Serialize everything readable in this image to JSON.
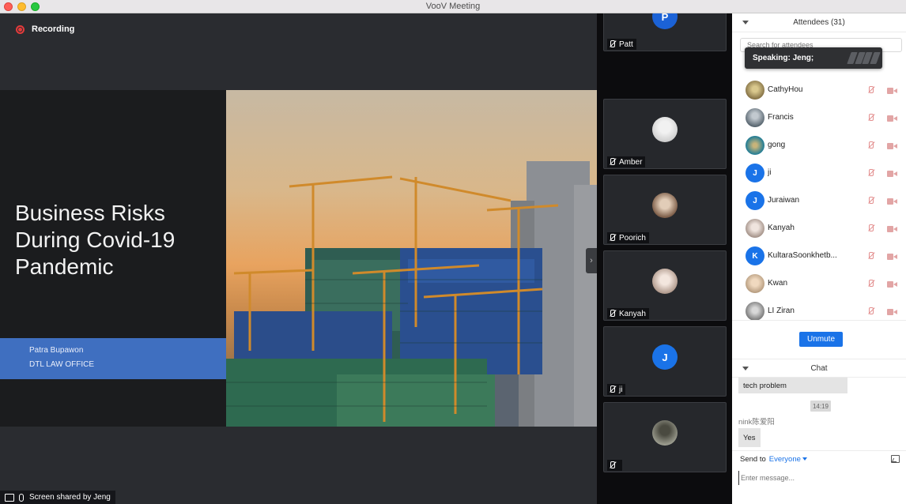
{
  "window": {
    "title": "VooV Meeting"
  },
  "recording": {
    "label": "Recording"
  },
  "slide": {
    "title": "Business Risks\nDuring Covid-19\nPandemic",
    "author": "Patra Bupawon",
    "org": "DTL LAW OFFICE"
  },
  "share_bar": {
    "label": "Screen shared by Jeng"
  },
  "video_tiles": [
    {
      "name": "Patt",
      "initial": "P",
      "avatar_color": "#1b62d6"
    },
    {
      "name": "Amber",
      "initial": "",
      "avatar_color": "#d7d7d7"
    },
    {
      "name": "Poorich",
      "initial": "",
      "avatar_color": "#b69a86"
    },
    {
      "name": "Kanyah",
      "initial": "",
      "avatar_color": "#dcd5cf"
    },
    {
      "name": "ji",
      "initial": "J",
      "avatar_color": "#1a73e8"
    },
    {
      "name": "",
      "initial": "",
      "avatar_color": "#8a8f86"
    }
  ],
  "attendees": {
    "title": "Attendees (31)",
    "search_placeholder": "Search for attendees",
    "speaking_tooltip": "Speaking: Jeng;",
    "items": [
      {
        "name": "CathyHou",
        "initial": "",
        "avatar_color": "#a58e5a"
      },
      {
        "name": "Francis",
        "initial": "",
        "avatar_color": "#5d6f7e"
      },
      {
        "name": "gong",
        "initial": "",
        "avatar_color": "#2f8fa8"
      },
      {
        "name": "ji",
        "initial": "J",
        "avatar_color": "#1a73e8"
      },
      {
        "name": "Juraiwan",
        "initial": "J",
        "avatar_color": "#1a73e8"
      },
      {
        "name": "Kanyah",
        "initial": "",
        "avatar_color": "#d4c9c4"
      },
      {
        "name": "KultaraSoonkhetb...",
        "initial": "K",
        "avatar_color": "#1a73e8"
      },
      {
        "name": "Kwan",
        "initial": "",
        "avatar_color": "#d9c2a8"
      },
      {
        "name": "LI Ziran",
        "initial": "",
        "avatar_color": "#8f8f8f"
      }
    ]
  },
  "unmute_button": {
    "label": "Unmute"
  },
  "chat": {
    "title": "Chat",
    "messages": [
      {
        "text": "tech problem"
      },
      {
        "time": "14:19"
      },
      {
        "sender": "nink陈爱阳",
        "text": "Yes"
      }
    ],
    "send_to_label": "Send to",
    "send_to_target": "Everyone",
    "input_placeholder": "Enter message..."
  }
}
